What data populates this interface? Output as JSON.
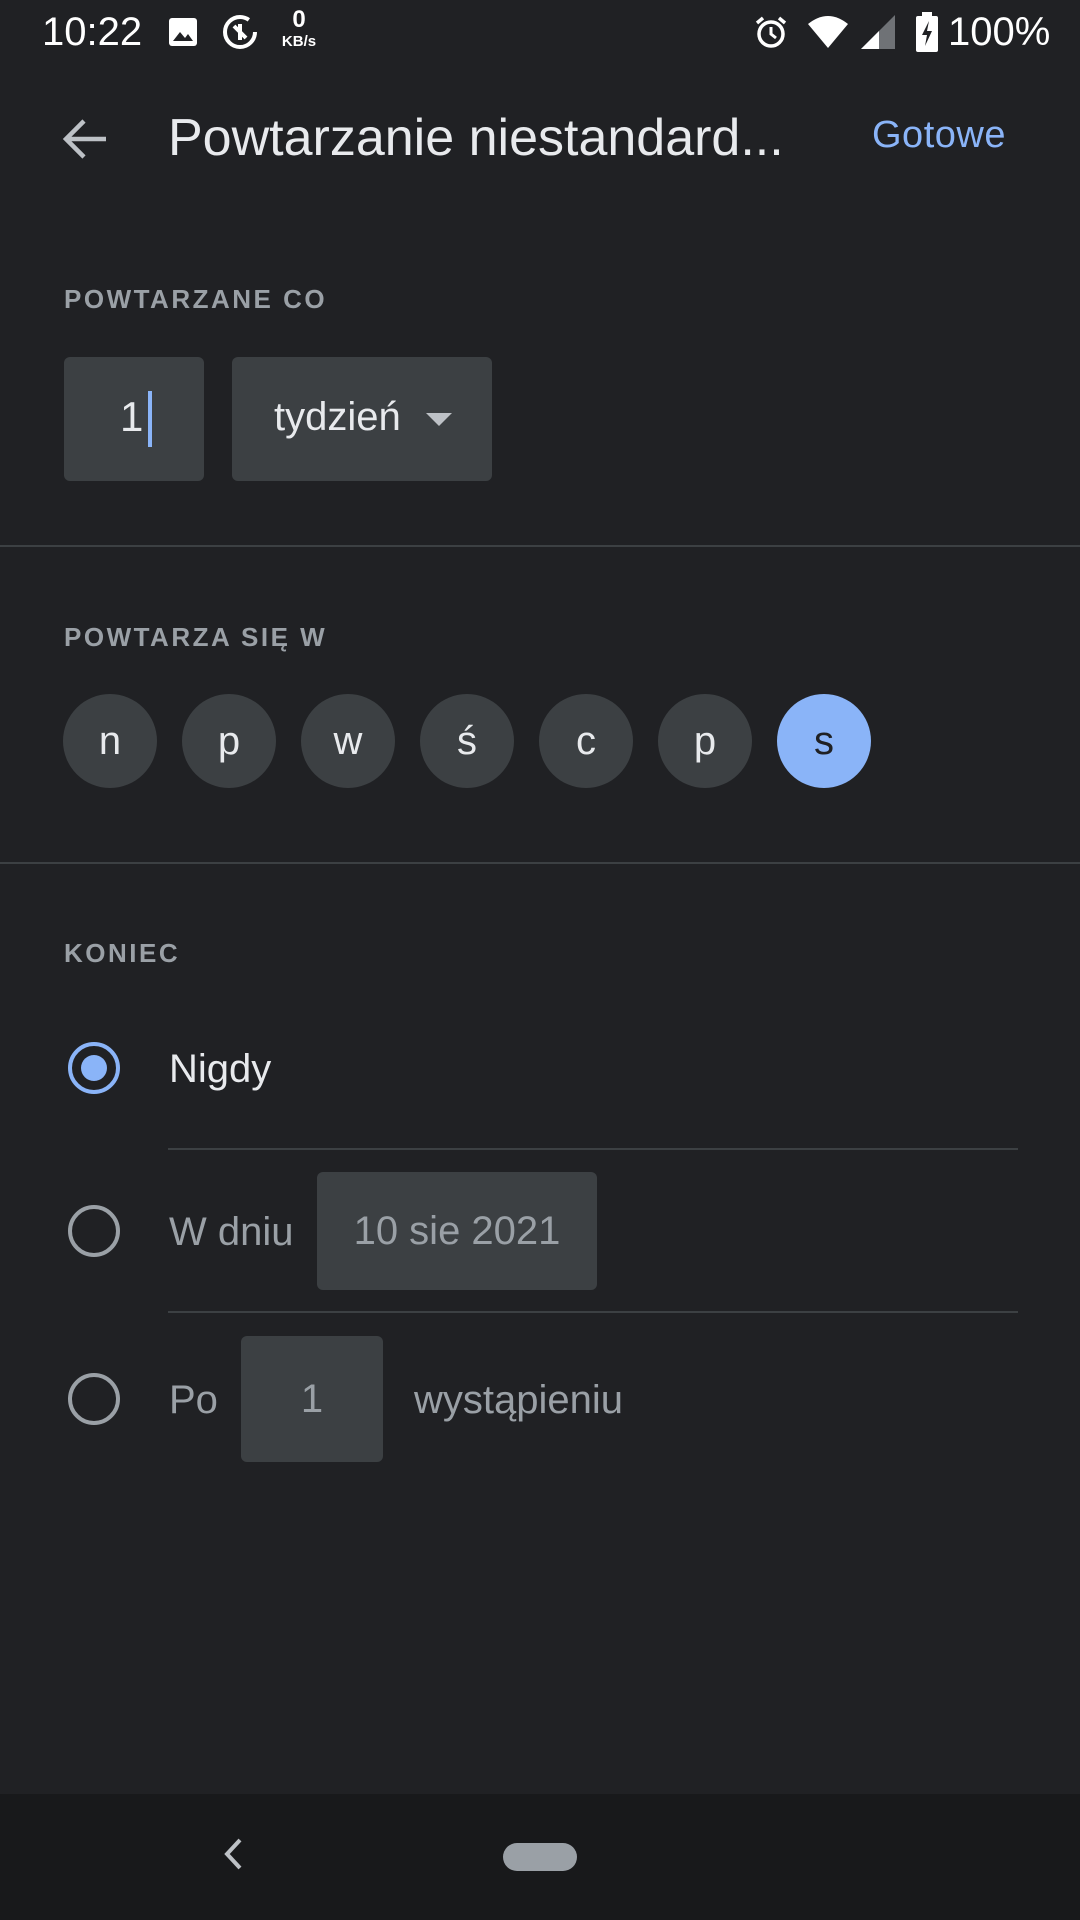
{
  "status_bar": {
    "time": "10:22",
    "net_speed_value": "0",
    "net_speed_unit": "KB/s",
    "battery": "100%",
    "icons": [
      "image-icon",
      "data-saver-icon",
      "alarm-icon",
      "wifi-icon",
      "signal-icon",
      "battery-charging-icon"
    ]
  },
  "app_bar": {
    "back_icon": "arrow-back-icon",
    "title": "Powtarzanie niestandard...",
    "done_label": "Gotowe"
  },
  "repeat_every": {
    "label": "POWTARZANE CO",
    "interval_value": "1",
    "unit_value": "tydzień"
  },
  "repeat_on": {
    "label": "POWTARZA SIĘ W",
    "days": [
      {
        "label": "n",
        "selected": false
      },
      {
        "label": "p",
        "selected": false
      },
      {
        "label": "w",
        "selected": false
      },
      {
        "label": "ś",
        "selected": false
      },
      {
        "label": "c",
        "selected": false
      },
      {
        "label": "p",
        "selected": false
      },
      {
        "label": "s",
        "selected": true
      }
    ]
  },
  "end": {
    "label": "KONIEC",
    "options": {
      "never": {
        "label": "Nigdy",
        "selected": true
      },
      "on_date": {
        "label": "W dniu",
        "date": "10 sie 2021",
        "selected": false
      },
      "after": {
        "prefix": "Po",
        "count": "1",
        "suffix": "wystąpieniu",
        "selected": false
      }
    }
  },
  "colors": {
    "background": "#202124",
    "accent": "#8ab4f8",
    "field": "#3c4043",
    "text_primary": "#e8eaed",
    "text_secondary": "#9aa0a6"
  }
}
